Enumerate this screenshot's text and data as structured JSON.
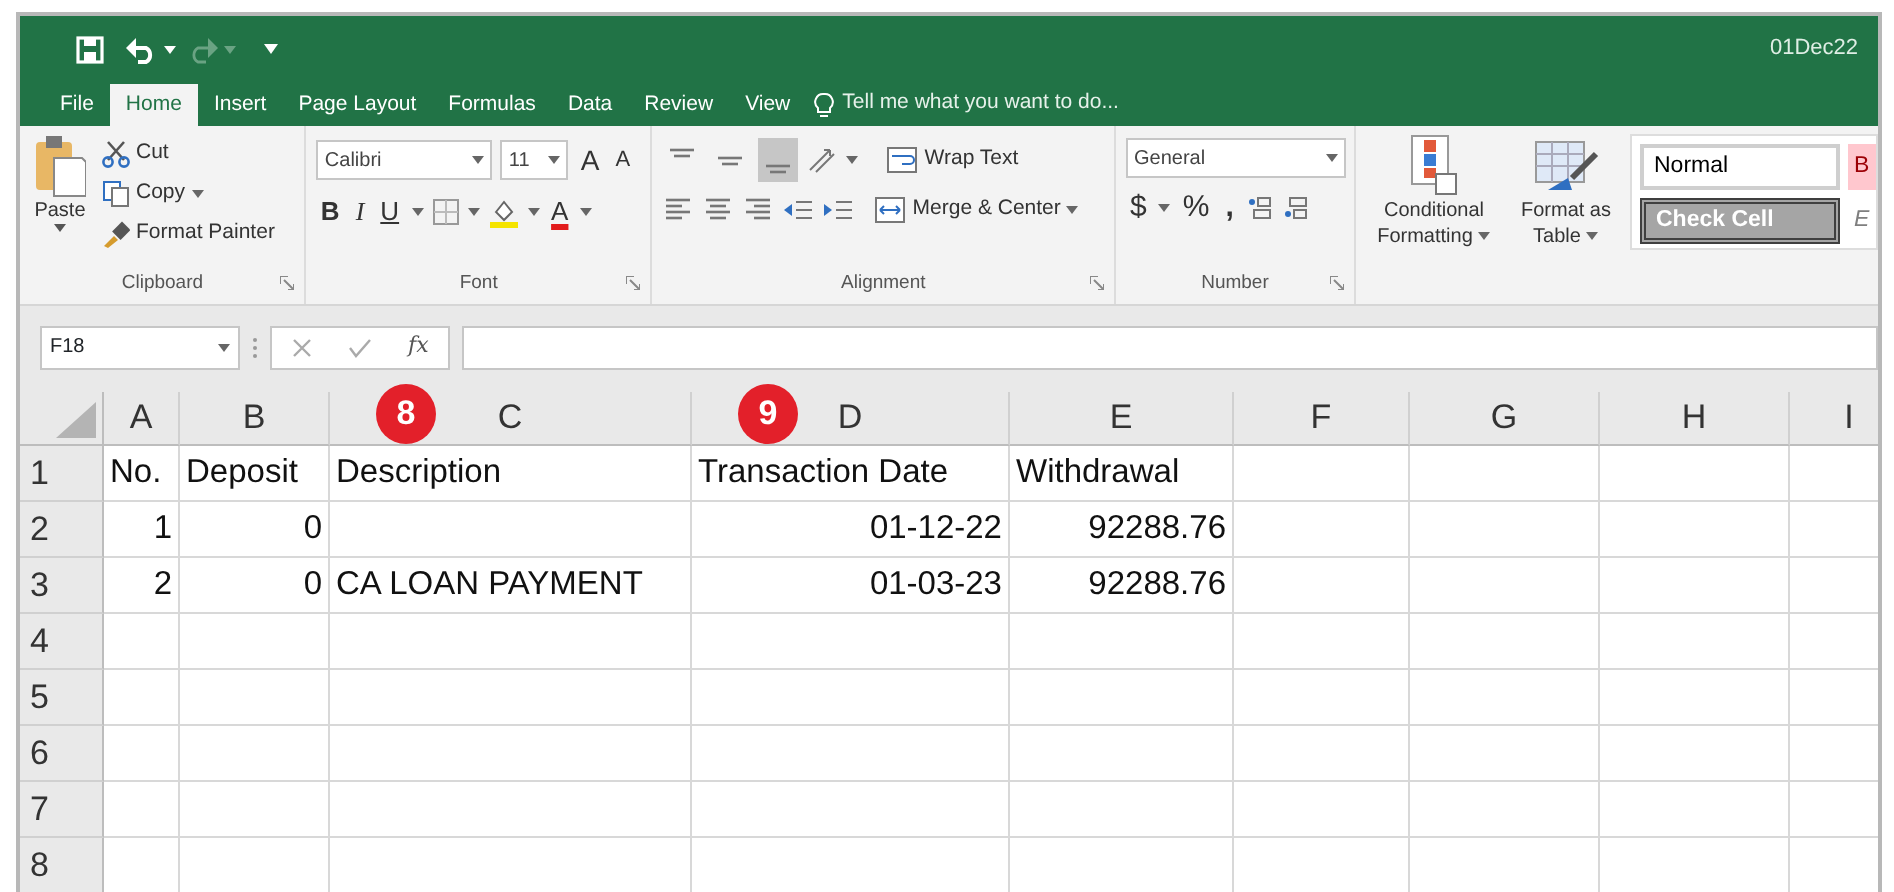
{
  "quick_access": [
    {
      "kind": "save",
      "disabled": false
    },
    {
      "kind": "undo",
      "disabled": false
    },
    {
      "kind": "redo",
      "disabled": true
    },
    {
      "kind": "customize",
      "disabled": false
    }
  ],
  "window": {
    "title": "01Dec22"
  },
  "tabs": [
    {
      "label": "File",
      "selected": false
    },
    {
      "label": "Home",
      "selected": true
    },
    {
      "label": "Insert",
      "selected": false
    },
    {
      "label": "Page Layout",
      "selected": false
    },
    {
      "label": "Formulas",
      "selected": false
    },
    {
      "label": "Data",
      "selected": false
    },
    {
      "label": "Review",
      "selected": false
    },
    {
      "label": "View",
      "selected": false
    }
  ],
  "tell_me": {
    "placeholder": "Tell me what you want to do..."
  },
  "clipboard": {
    "paste": "Paste",
    "cut": "Cut",
    "copy": "Copy",
    "format_painter": "Format Painter",
    "label": "Clipboard"
  },
  "font": {
    "name": "Calibri",
    "size": "11",
    "grow": "A",
    "shrink": "A",
    "styles": [
      {
        "label": "B",
        "kind": "bold"
      },
      {
        "label": "I",
        "kind": "italic"
      },
      {
        "label": "U",
        "kind": "underline"
      }
    ],
    "font_color": "A",
    "label": "Font"
  },
  "alignment": {
    "vertical": [
      {
        "selected": false
      },
      {
        "selected": false
      },
      {
        "selected": true
      }
    ],
    "wrap": "Wrap Text",
    "merge": "Merge & Center",
    "label": "Alignment"
  },
  "number": {
    "format": "General",
    "symbols": [
      "$",
      "%",
      ","
    ],
    "label": "Number"
  },
  "styles": {
    "conditional": "Conditional Formatting",
    "format_table": "Format as Table",
    "cells": [
      {
        "label": "Normal",
        "kind": "normal"
      },
      {
        "label": "B",
        "kind": "bad"
      },
      {
        "label": "Check Cell",
        "kind": "check"
      },
      {
        "label": "E",
        "kind": "explanatory"
      }
    ]
  },
  "formula_bar": {
    "name_box": "F18",
    "fx": "fx"
  },
  "columns": [
    {
      "label": "A"
    },
    {
      "label": "B"
    },
    {
      "label": "C",
      "callout": "8"
    },
    {
      "label": "D",
      "callout": "9"
    },
    {
      "label": "E"
    },
    {
      "label": "F"
    },
    {
      "label": "G"
    },
    {
      "label": "H"
    },
    {
      "label": "I"
    }
  ],
  "rows": [
    {
      "number": "1",
      "cells": [
        {
          "text": "No.",
          "kind": "text"
        },
        {
          "text": "Deposit",
          "kind": "text"
        },
        {
          "text": "Description",
          "kind": "text"
        },
        {
          "text": "Transaction Date",
          "kind": "text"
        },
        {
          "text": "Withdrawal",
          "kind": "text"
        }
      ]
    },
    {
      "number": "2",
      "cells": [
        {
          "text": "1",
          "kind": "number"
        },
        {
          "text": "0",
          "kind": "number"
        },
        {
          "kind": "empty"
        },
        {
          "text": "01-12-22",
          "kind": "number"
        },
        {
          "text": "92288.76",
          "kind": "number"
        }
      ]
    },
    {
      "number": "3",
      "cells": [
        {
          "text": "2",
          "kind": "number"
        },
        {
          "text": "0",
          "kind": "number"
        },
        {
          "text": "CA LOAN PAYMENT",
          "kind": "text"
        },
        {
          "text": "01-03-23",
          "kind": "number"
        },
        {
          "text": "92288.76",
          "kind": "number"
        }
      ]
    },
    {
      "number": "4"
    },
    {
      "number": "5"
    },
    {
      "number": "6"
    },
    {
      "number": "7"
    },
    {
      "number": "8"
    }
  ]
}
